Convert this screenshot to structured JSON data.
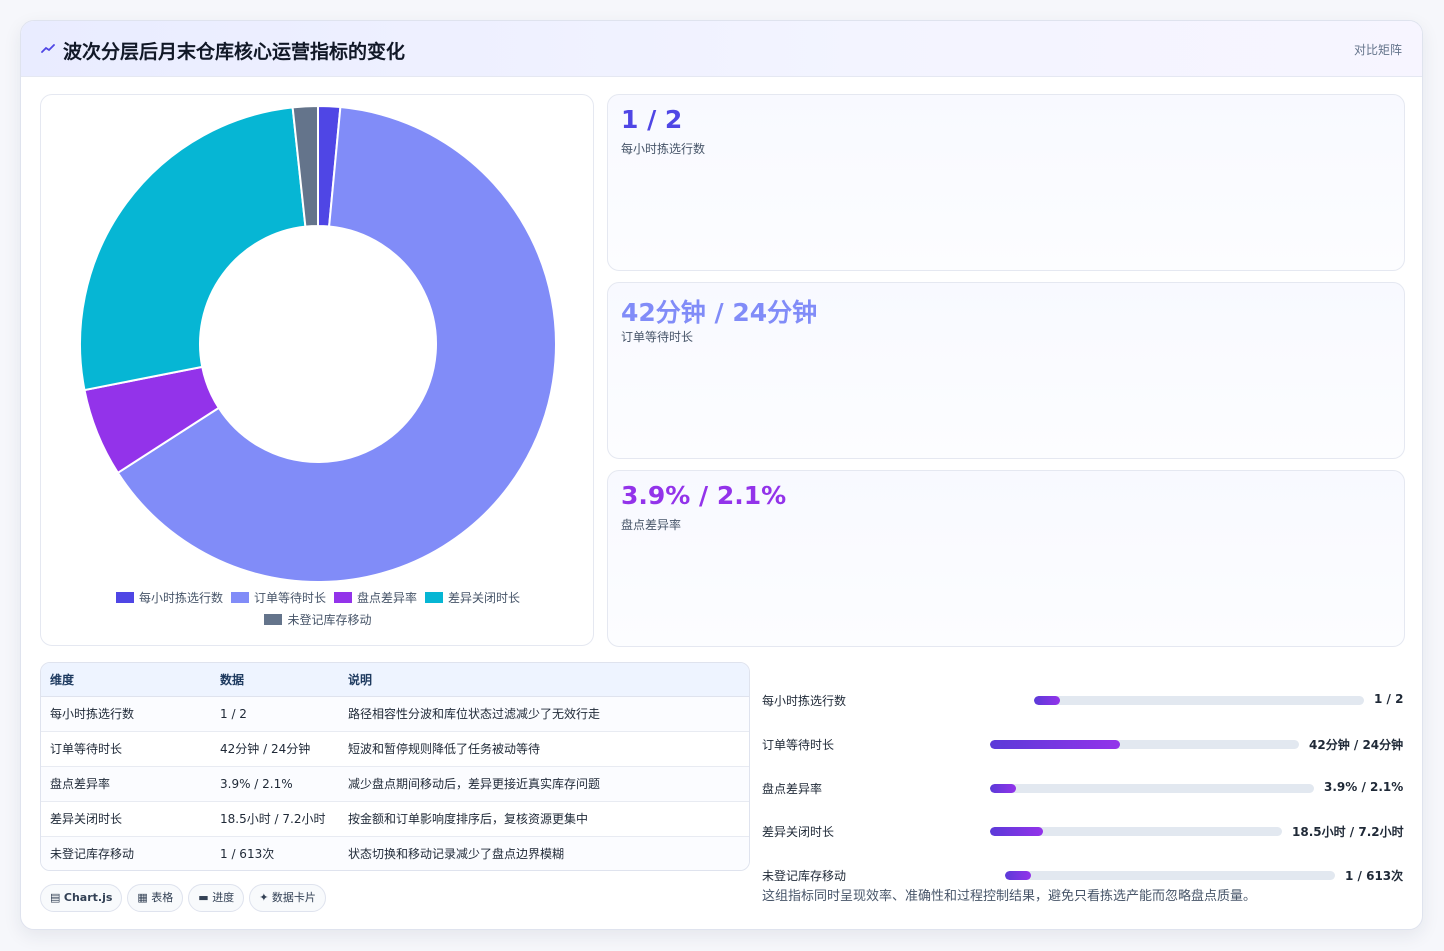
{
  "header": {
    "title": "波次分层后月末仓库核心运营指标的变化",
    "link_label": "对比矩阵",
    "icon": "trend-icon"
  },
  "colors": {
    "indigo": "#4f46e5",
    "periwinkle": "#818cf8",
    "purple": "#9333ea",
    "cyan": "#06b6d4",
    "slate": "#64748b"
  },
  "chart_data": {
    "type": "pie",
    "variant": "doughnut",
    "labels": [
      "每小时拣选行数",
      "订单等待时长",
      "盘点差异率",
      "差异关闭时长",
      "未登记库存移动"
    ],
    "values": [
      1.5,
      64.4,
      6.0,
      26.4,
      1.7
    ],
    "colors": [
      "#4f46e5",
      "#818cf8",
      "#9333ea",
      "#06b6d4",
      "#64748b"
    ],
    "legend_position": "bottom"
  },
  "stats": [
    {
      "value": "1 / 2",
      "label": "每小时拣选行数",
      "color": "#4f46e5"
    },
    {
      "value": "42分钟 / 24分钟",
      "label": "订单等待时长",
      "color": "#818cf8"
    },
    {
      "value": "3.9% / 2.1%",
      "label": "盘点差异率",
      "color": "#9333ea"
    }
  ],
  "table": {
    "headers": [
      "维度",
      "数据",
      "说明"
    ],
    "rows": [
      [
        "每小时拣选行数",
        "1 / 2",
        "路径相容性分波和库位状态过滤减少了无效行走"
      ],
      [
        "订单等待时长",
        "42分钟 / 24分钟",
        "短波和暂停规则降低了任务被动等待"
      ],
      [
        "盘点差异率",
        "3.9% / 2.1%",
        "减少盘点期间移动后，差异更接近真实库存问题"
      ],
      [
        "差异关闭时长",
        "18.5小时 / 7.2小时",
        "按金额和订单影响度排序后，复核资源更集中"
      ],
      [
        "未登记库存移动",
        "1 / 613次",
        "状态切换和移动记录减少了盘点边界模糊"
      ]
    ]
  },
  "progress": [
    {
      "label": "每小时拣选行数",
      "value": "1 / 2",
      "fill_pct": 8
    },
    {
      "label": "订单等待时长",
      "value": "42分钟 / 24分钟",
      "fill_pct": 42
    },
    {
      "label": "盘点差异率",
      "value": "3.9% / 2.1%",
      "fill_pct": 8
    },
    {
      "label": "差异关闭时长",
      "value": "18.5小时 / 7.2小时",
      "fill_pct": 18
    },
    {
      "label": "未登记库存移动",
      "value": "1 / 613次",
      "fill_pct": 8
    }
  ],
  "chips": [
    {
      "icon": "chart-icon",
      "glyph": "▤",
      "label": "Chart.js",
      "bold": true
    },
    {
      "icon": "table-icon",
      "glyph": "▦",
      "label": "表格",
      "bold": false
    },
    {
      "icon": "progress-icon",
      "glyph": "▬",
      "label": "进度",
      "bold": false
    },
    {
      "icon": "sparkle-icon",
      "glyph": "✦",
      "label": "数据卡片",
      "bold": false
    }
  ],
  "note": "这组指标同时呈现效率、准确性和过程控制结果，避免只看拣选产能而忽略盘点质量。"
}
